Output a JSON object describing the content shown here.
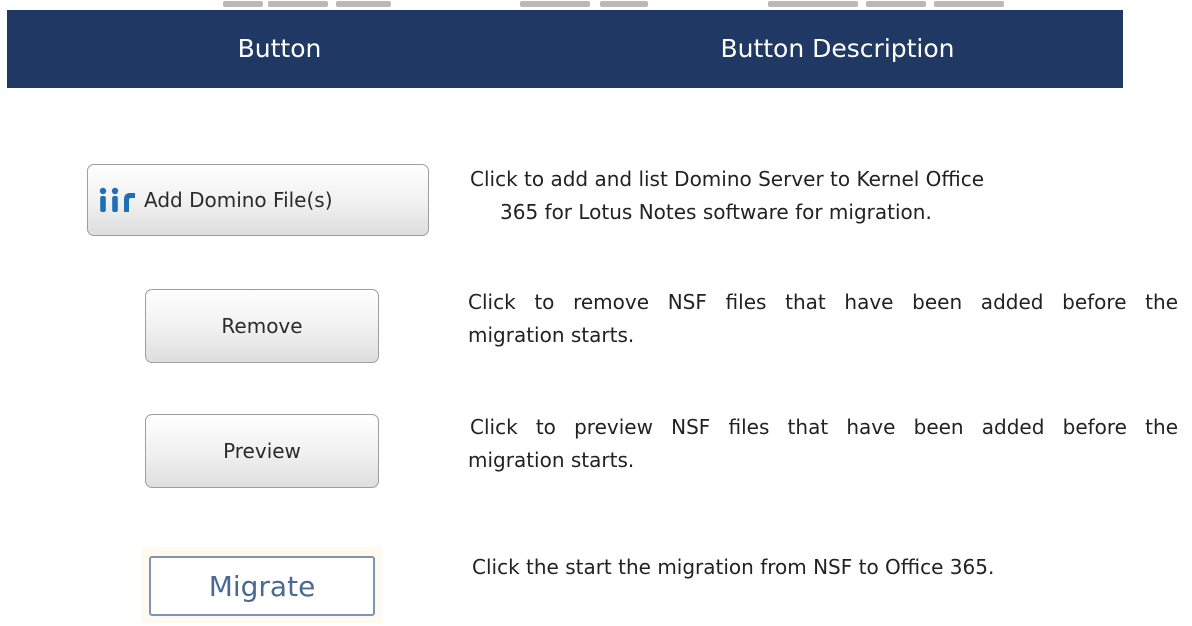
{
  "header": {
    "col_button": "Button",
    "col_description": "Button Description"
  },
  "rows": [
    {
      "button_label": "Add Domino File(s)",
      "icon": "people-group-icon",
      "description_lines": [
        "Click to add and list Domino Server to Kernel Office",
        "365 for Lotus Notes software for migration."
      ]
    },
    {
      "button_label": "Remove",
      "description_lines": [
        "Click to remove NSF files that have been added before the",
        "migration starts."
      ]
    },
    {
      "button_label": "Preview",
      "description_lines": [
        "Click to preview NSF files that have been added before the",
        "migration starts."
      ]
    },
    {
      "button_label": "Migrate",
      "description_lines": [
        "Click the start the migration from NSF to Office 365."
      ]
    }
  ],
  "colors": {
    "header_bg": "#1f3864",
    "migrate_text": "#4a6a93",
    "icon_blue": "#1f6fb5"
  }
}
